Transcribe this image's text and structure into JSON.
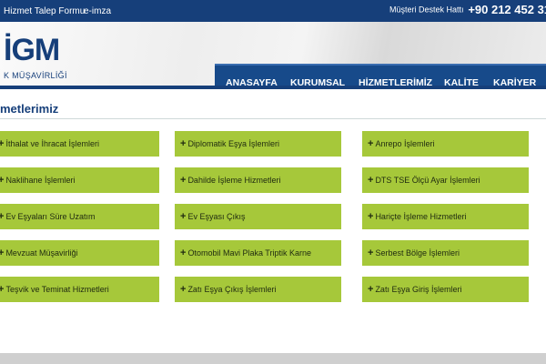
{
  "topbar": {
    "links": [
      "Hizmet Talep Formu",
      "e-imza"
    ],
    "support_label": "Müşteri Destek Hattı",
    "support_phone": "+90 212 452 31"
  },
  "logo": {
    "title": "İGM",
    "subtitle": "K MÜŞAVİRLİĞİ"
  },
  "nav": {
    "items": [
      "ANASAYFA",
      "KURUMSAL",
      "HİZMETLERİMİZ",
      "KALİTE",
      "KARİYER"
    ]
  },
  "section": {
    "title": "metlerimiz"
  },
  "services": [
    [
      "İthalat ve İhracat İşlemleri",
      "Diplomatik Eşya İşlemleri",
      "Anrepo İşlemleri"
    ],
    [
      "Naklihane İşlemleri",
      "Dahilde İşleme Hizmetleri",
      "DTS TSE Ölçü Ayar İşlemleri"
    ],
    [
      "Ev Eşyaları Süre Uzatım",
      "Ev Eşyası Çıkış",
      "Hariçte İşleme Hizmetleri"
    ],
    [
      "Mevzuat Müşavirliği",
      "Otomobil Mavi Plaka Triptik Karne",
      "Serbest Bölge İşlemleri"
    ],
    [
      "Teşvik ve Teminat Hizmetleri",
      "Zatı Eşya Çıkış İşlemleri",
      "Zatı Eşya Giriş İşlemleri"
    ]
  ],
  "icons": {
    "plus": "plus-icon"
  },
  "colors": {
    "primary": "#163f7a",
    "nav": "#174a8a",
    "card": "#a6c83a"
  }
}
